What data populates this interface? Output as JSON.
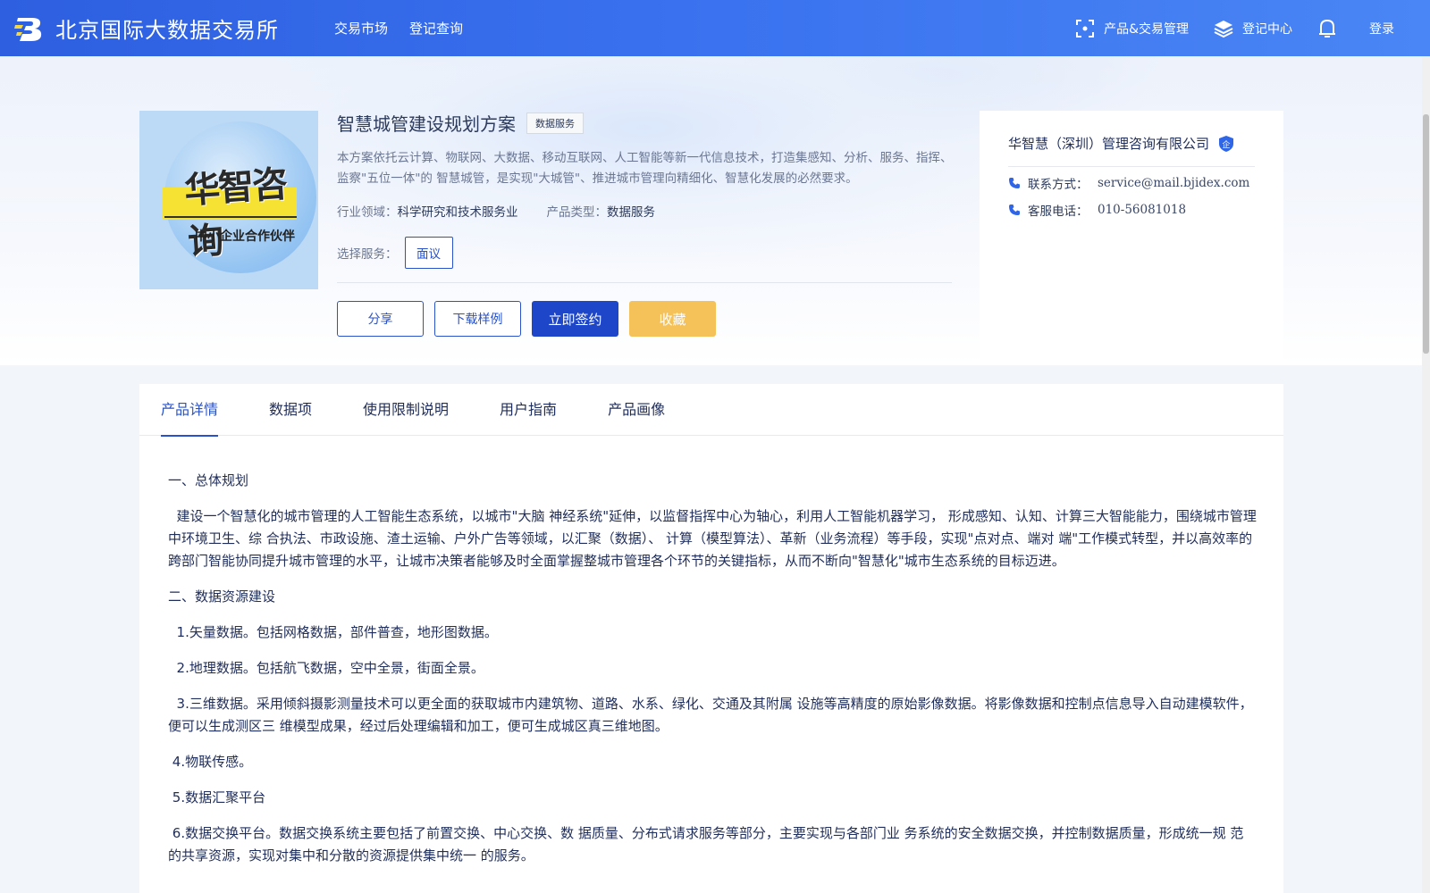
{
  "header": {
    "logo_text": "北京国际大数据交易所",
    "nav": [
      "交易市场",
      "登记查询"
    ],
    "product_mgmt": "产品&交易管理",
    "register_center": "登记中心",
    "login": "登录"
  },
  "product": {
    "title": "智慧城管建设规划方案",
    "tag": "数据服务",
    "description": "本方案依托云计算、物联网、大数据、移动互联网、人工智能等新一代信息技术，打造集感知、分析、服务、指挥、监察\"五位一体\"的 智慧城管，是实现\"大城管\"、推进城市管理向精细化、智慧化发展的必然要求。",
    "industry_label": "行业领域：",
    "industry_value": "科学研究和技术服务业",
    "type_label": "产品类型：",
    "type_value": "数据服务",
    "service_label": "选择服务：",
    "service_option": "面议",
    "image_text_main": "华智咨询",
    "image_text_sub": "中小企业合作伙伴",
    "buttons": {
      "share": "分享",
      "download": "下载样例",
      "sign": "立即签约",
      "favorite": "收藏"
    }
  },
  "company": {
    "name": "华智慧（深圳）管理咨询有限公司",
    "badge": "企",
    "contact_label": "联系方式：",
    "contact_value": "service@mail.bjidex.com",
    "phone_label": "客服电话：",
    "phone_value": "010-56081018"
  },
  "tabs": [
    "产品详情",
    "数据项",
    "使用限制说明",
    "用户指南",
    "产品画像"
  ],
  "active_tab": 0,
  "content": {
    "paragraphs": [
      "一、总体规划",
      "  建设一个智慧化的城市管理的人工智能生态系统，以城市\"大脑 神经系统\"延伸，以监督指挥中心为轴心，利用人工智能机器学习， 形成感知、认知、计算三大智能能力，围绕城市管理中环境卫生、综 合执法、市政设施、渣土运输、户外广告等领域，以汇聚（数据）、 计算（模型算法）、革新（业务流程）等手段，实现\"点对点、端对 端\"工作模式转型，并以高效率的跨部门智能协同提升城市管理的水平，让城市决策者能够及时全面掌握整城市管理各个环节的关键指标，从而不断向\"智慧化\"城市生态系统的目标迈进。",
      "二、数据资源建设",
      "  1.矢量数据。包括网格数据，部件普查，地形图数据。",
      "  2.地理数据。包括航飞数据，空中全景，街面全景。",
      "  3.三维数据。采用倾斜摄影测量技术可以更全面的获取城市内建筑物、道路、水系、绿化、交通及其附属 设施等高精度的原始影像数据。将影像数据和控制点信息导入自动建模软件，便可以生成测区三 维模型成果，经过后处理编辑和加工，便可生成城区真三维地图。",
      " 4.物联传感。",
      " 5.数据汇聚平台",
      " 6.数据交换平台。数据交换系统主要包括了前置交换、中心交换、数 据质量、分布式请求服务等部分，主要实现与各部门业 务系统的安全数据交换，并控制数据质量，形成统一规 范的共享资源，实现对集中和分散的资源提供集中统一 的服务。"
    ]
  },
  "colors": {
    "header_blue": "#3a72ef",
    "primary": "#1e46c8",
    "favorite": "#f5c25a"
  }
}
